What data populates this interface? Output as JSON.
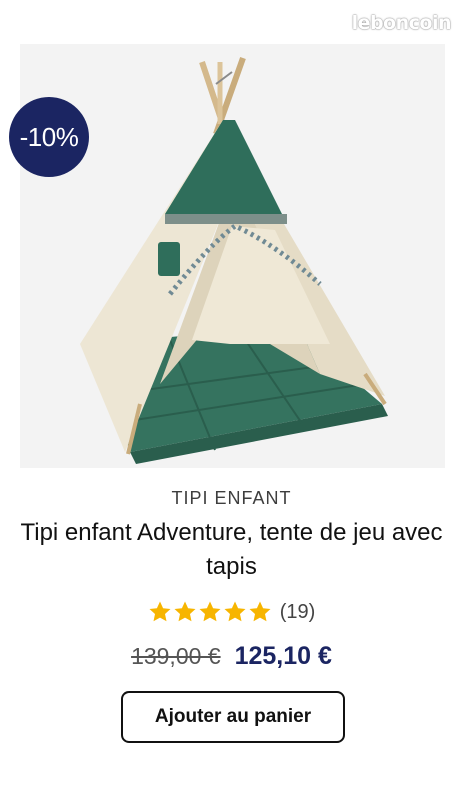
{
  "watermark": "leboncoin",
  "product": {
    "image_alt": "Tipi enfant vert et écru avec tapis",
    "discount_badge": "-10%",
    "brand": "TIPI ENFANT",
    "title": "Tipi enfant Adventure, tente de jeu avec tapis",
    "rating": {
      "stars": 5,
      "max_stars": 5,
      "review_count_label": "(19)"
    },
    "old_price": "139,00 €",
    "new_price": "125,10 €",
    "add_to_cart_label": "Ajouter au panier"
  },
  "colors": {
    "badge": "#1b2562",
    "price": "#1b2562",
    "star": "#f7b500",
    "tent_green": "#2e6b59",
    "tent_canvas": "#ebe3d0"
  }
}
